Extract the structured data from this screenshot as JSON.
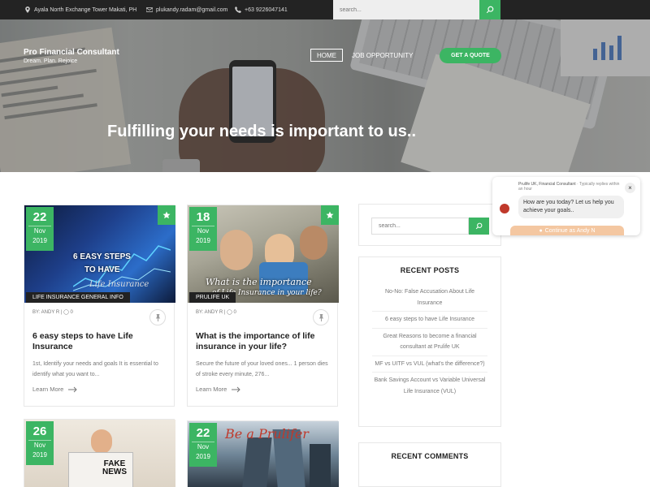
{
  "topbar": {
    "address": "Ayala North Exchange Tower Makati, PH",
    "email": "plukandy.radam@gmail.com",
    "phone": "+63 9226047141",
    "search_placeholder": "search..."
  },
  "brand": {
    "title": "Pro Financial Consultant",
    "tagline": "Dream. Plan. Rejoice"
  },
  "nav": {
    "home": "HOME",
    "job": "JOB OPPORTUNITY",
    "cta": "GET A QUOTE"
  },
  "hero": {
    "title": "Fulfilling your needs is important to us.."
  },
  "posts": [
    {
      "day": "22",
      "month": "Nov",
      "year": "2019",
      "image_text": [
        "6 EASY STEPS",
        "TO HAVE",
        "Life Insurance"
      ],
      "category": "LIFE INSURANCE GENERAL INFO",
      "author": "BY: ANDY R",
      "comments": "0",
      "title": "6 easy steps to have Life Insurance",
      "excerpt": "1st, Identify your needs and goals It is essential to identify what you want to...",
      "read_more": "Learn More"
    },
    {
      "day": "18",
      "month": "Nov",
      "year": "2019",
      "image_text": [
        "What is the importance",
        "of Life Insurance in your life?"
      ],
      "category": "PRULIFE UK",
      "author": "BY: ANDY R",
      "comments": "0",
      "title": "What is the importance of life insurance in your life?",
      "excerpt": "Secure the future of your loved ones... 1 person dies of stroke every minute, 276...",
      "read_more": "Learn More"
    },
    {
      "day": "26",
      "month": "Nov",
      "year": "2019",
      "image_text": [
        "FAKE",
        "NEWS"
      ]
    },
    {
      "day": "22",
      "month": "Nov",
      "year": "2019",
      "image_text": [
        "Be a Prulifer"
      ]
    }
  ],
  "sidebar": {
    "search_placeholder": "search...",
    "recent_posts_title": "RECENT POSTS",
    "recent_posts": [
      "No-No: False Accusation About Life Insurance",
      "6 easy steps to have Life Insurance",
      "Great Reasons to become a financial consultant at Prulife UK",
      "MF vs UITF vs VUL (what's the difference?)",
      "Bank Savings Account vs Variable Universal Life Insurance (VUL)"
    ],
    "recent_comments_title": "RECENT COMMENTS"
  },
  "chat": {
    "page_name": "Prulife UK, Financial Consultant",
    "reply_time": "· Typically replies within an hour",
    "message": "How are you today? Let us help you achieve your goals..",
    "continue_label": "Continue as Andy N",
    "close": "×"
  },
  "colors": {
    "accent": "#3cb563",
    "topbar": "#232323",
    "category_tag": "#222222"
  },
  "icons": [
    "map-pin-icon",
    "mail-icon",
    "phone-icon",
    "search-icon",
    "star-icon",
    "pin-icon",
    "comment-icon",
    "arrow-right-icon",
    "close-icon",
    "messenger-icon"
  ]
}
